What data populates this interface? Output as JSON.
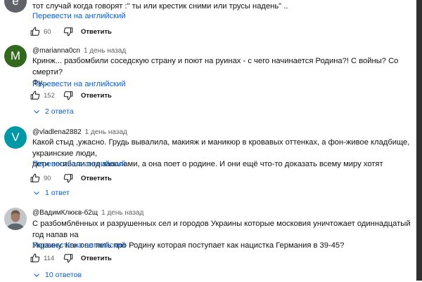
{
  "comment0": {
    "avatar_letter": "е",
    "avatar_color": "#5f6368",
    "text": "тот случай когда говорят :\" ты или крестик сними или трусы надень\" ..",
    "translate": "Перевести на английский",
    "likes": "60",
    "reply": "Ответить"
  },
  "comment1": {
    "avatar_letter": "M",
    "avatar_color": "#33691e",
    "author": "@marianna0cn",
    "time": "1 день назад",
    "text_line1": "Кринж... разбомбили соседскую страну и поют на руинах - с чего начинается Родина?! С войны? Со смерти?",
    "text_line2": "Фу...",
    "translate": "Перевести на английский",
    "likes": "152",
    "reply": "Ответить",
    "replies": "2 ответа"
  },
  "comment2": {
    "avatar_letter": "V",
    "avatar_color": "#0097a7",
    "author": "@vladlena2882",
    "time": "1 день назад",
    "text_line1": "Какой стыд ,ужасно. Грудь вывалила, макияж и маникюр в кровавых оттенках, а фон-живое кладбище, украинские люди,",
    "text_line2": "дети погибали под завалами, а она поет о родине. И они ещё что-то доказать всему миру хотят",
    "translate": "Перевести на английский",
    "likes": "90",
    "reply": "Ответить",
    "replies": "1 ответ"
  },
  "comment3": {
    "author": "@ВадимКлюєв-б2щ",
    "time": "1 день назад",
    "text_line1": "С разбомблённых и разрушенных сел и городов Украины которые московия уничтожает одиннадцатый год напав на",
    "text_line2": "Украину. Как оно петь про Родину которая поступает как нацистка Германия в 39-45?",
    "translate": "Перевести на английский",
    "likes": "114",
    "reply": "Ответить",
    "replies": "10 ответов"
  },
  "colors": {
    "link": "#065fd4",
    "text": "#0f0f0f",
    "meta": "#606060"
  },
  "icons": [
    "thumb-up-icon",
    "thumb-down-icon",
    "chevron-down-icon"
  ]
}
